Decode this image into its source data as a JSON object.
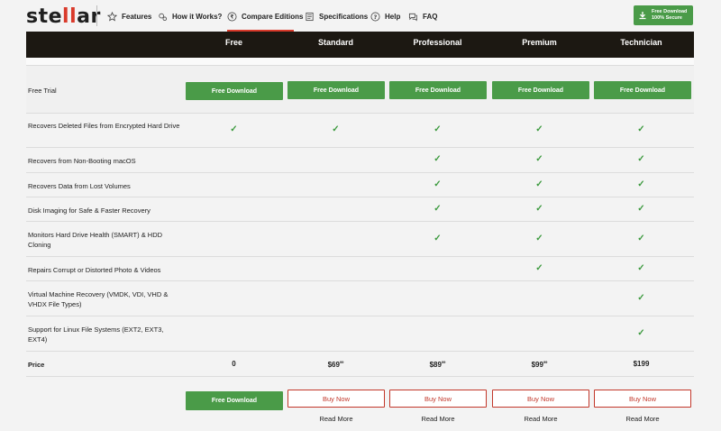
{
  "header": {
    "logo_pre": "ste",
    "logo_mid": "ll",
    "logo_post": "ar",
    "nav": [
      {
        "label": "Features",
        "icon": "star-icon"
      },
      {
        "label": "How it Works?",
        "icon": "gears-icon"
      },
      {
        "label": "Compare Editions",
        "icon": "currency-icon"
      },
      {
        "label": "Specifications",
        "icon": "document-icon"
      },
      {
        "label": "Help",
        "icon": "help-icon"
      },
      {
        "label": "FAQ",
        "icon": "chat-icon"
      }
    ],
    "active_nav": "Compare Editions",
    "download_btn_line1": "Free Download",
    "download_btn_line2": "100% Secure"
  },
  "editions": [
    "Free",
    "Standard",
    "Professional",
    "Premium",
    "Technician"
  ],
  "free_trial": {
    "label": "Free Trial",
    "button_label": "Free Download"
  },
  "features": [
    {
      "label": "Recovers Deleted Files from Encrypted Hard Drive",
      "checks": [
        true,
        true,
        true,
        true,
        true
      ]
    },
    {
      "label": "Recovers from Non-Booting macOS",
      "checks": [
        false,
        false,
        true,
        true,
        true
      ]
    },
    {
      "label": "Recovers Data from Lost Volumes",
      "checks": [
        false,
        false,
        true,
        true,
        true
      ]
    },
    {
      "label": "Disk Imaging for Safe & Faster Recovery",
      "checks": [
        false,
        false,
        true,
        true,
        true
      ]
    },
    {
      "label": "Monitors Hard Drive Health (SMART) & HDD Cloning",
      "checks": [
        false,
        false,
        true,
        true,
        true
      ]
    },
    {
      "label": "Repairs Corrupt or Distorted Photo & Videos",
      "checks": [
        false,
        false,
        false,
        true,
        true
      ]
    },
    {
      "label": "Virtual Machine Recovery (VMDK, VDI, VHD & VHDX File Types)",
      "checks": [
        false,
        false,
        false,
        false,
        true
      ]
    },
    {
      "label": "Support for Linux File Systems (EXT2, EXT3, EXT4)",
      "checks": [
        false,
        false,
        false,
        false,
        true
      ]
    }
  ],
  "price": {
    "label": "Price",
    "values": [
      {
        "main": "0",
        "cents": ""
      },
      {
        "main": "$69",
        "cents": "99"
      },
      {
        "main": "$89",
        "cents": "99"
      },
      {
        "main": "$99",
        "cents": "99"
      },
      {
        "main": "$199",
        "cents": ""
      }
    ]
  },
  "bottom": {
    "free_download_label": "Free Download",
    "buy_now_label": "Buy Now",
    "read_more_label": "Read More"
  },
  "check_glyph": "✓",
  "colors": {
    "brand_red": "#d93a2b",
    "green": "#4a9b48",
    "dark_band": "#1c1812"
  }
}
